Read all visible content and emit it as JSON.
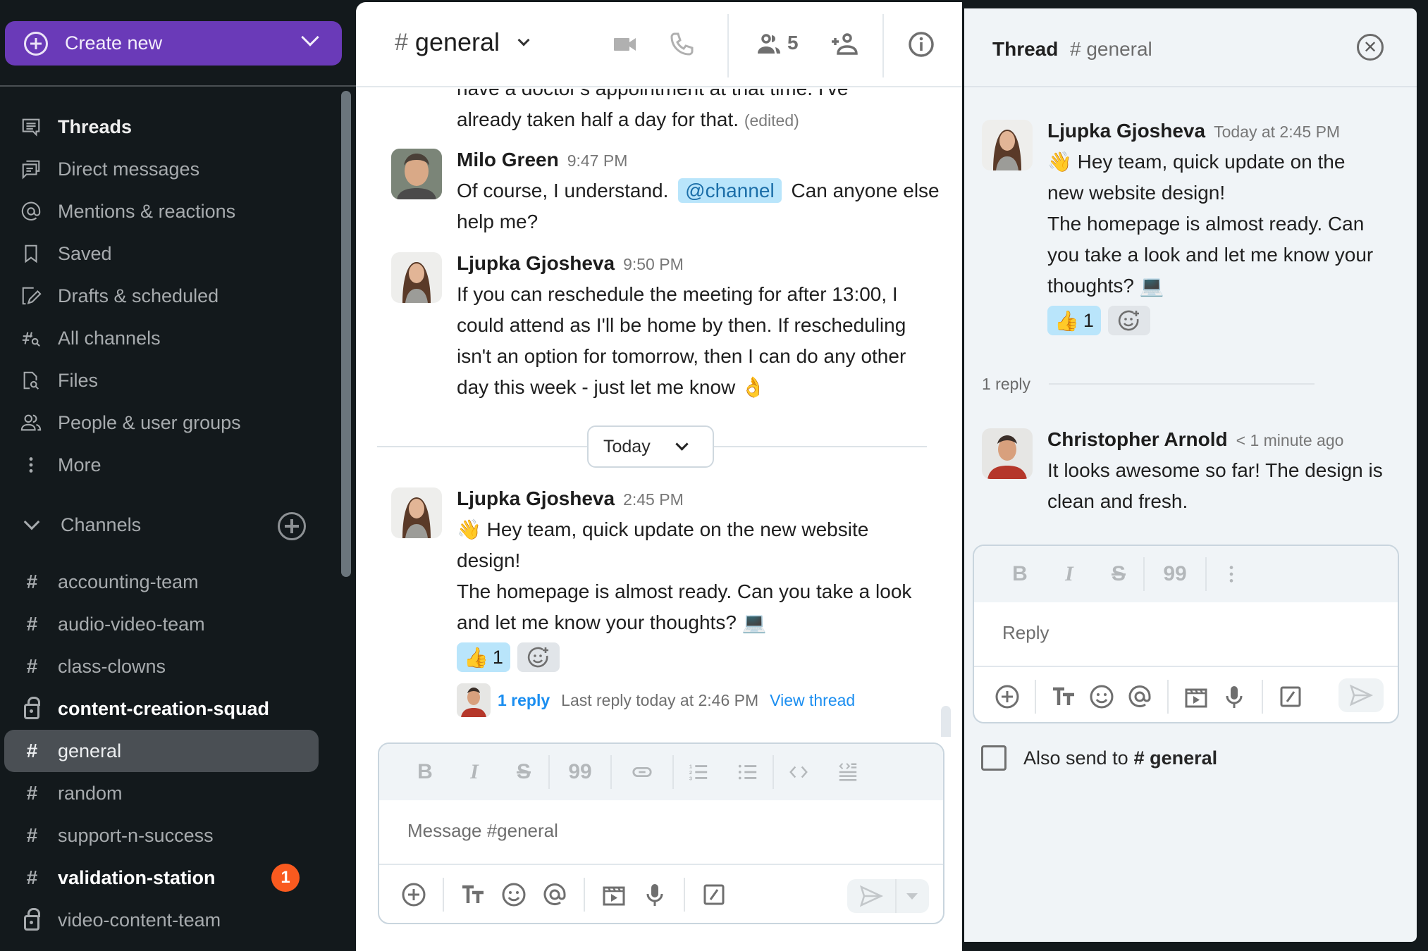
{
  "sidebar": {
    "create_button": {
      "label": "Create new",
      "color": "#6a3ab8"
    },
    "nav_items": [
      {
        "label": "Threads",
        "icon": "threads-icon",
        "bold": true
      },
      {
        "label": "Direct messages",
        "icon": "direct-messages-icon"
      },
      {
        "label": "Mentions & reactions",
        "icon": "at-sign-icon"
      },
      {
        "label": "Saved",
        "icon": "bookmark-icon"
      },
      {
        "label": "Drafts & scheduled",
        "icon": "drafts-icon"
      },
      {
        "label": "All channels",
        "icon": "channel-search-icon"
      },
      {
        "label": "Files",
        "icon": "file-search-icon"
      },
      {
        "label": "People & user groups",
        "icon": "people-icon"
      },
      {
        "label": "More",
        "icon": "more-vertical-icon"
      }
    ],
    "channels_header": "Channels",
    "channels": [
      {
        "name": "accounting-team",
        "type": "public"
      },
      {
        "name": "audio-video-team",
        "type": "public"
      },
      {
        "name": "class-clowns",
        "type": "public"
      },
      {
        "name": "content-creation-squad",
        "type": "private",
        "bold": true
      },
      {
        "name": "general",
        "type": "public",
        "active": true
      },
      {
        "name": "random",
        "type": "public"
      },
      {
        "name": "support-n-success",
        "type": "public"
      },
      {
        "name": "validation-station",
        "type": "public",
        "bold": true,
        "badge": "1"
      },
      {
        "name": "video-content-team",
        "type": "private"
      }
    ],
    "badge_color": "#f95a1f"
  },
  "main": {
    "header": {
      "hash": "#",
      "channel": "general",
      "member_count": "5"
    },
    "cutoff_text_top": "have a doctor's appointment at that time. I've",
    "cutoff_text": "already taken half a day for that.",
    "edited_label": "(edited)",
    "messages": [
      {
        "author": "Milo Green",
        "time": "9:47 PM",
        "text_before": "Of course, I understand.",
        "mention": "@channel",
        "text_after": "Can anyone else help me?"
      },
      {
        "author": "Ljupka Gjosheva",
        "time": "9:50 PM",
        "text": "If you can reschedule the meeting for after 13:00, I could attend as I'll be home by then. If rescheduling isn't an option for tomorrow, then I can do any other day this week - just let me know",
        "emoji": "👌"
      }
    ],
    "date_divider": "Today",
    "latest": {
      "author": "Ljupka Gjosheva",
      "time": "2:45 PM",
      "emoji_start": "👋",
      "line1": "Hey team, quick update on the new website design!",
      "line2": "The homepage is almost ready. Can you take a look and let me know your thoughts?",
      "emoji_end": "💻",
      "reaction_emoji": "👍",
      "reaction_count": "1",
      "reply_count": "1 reply",
      "last_reply": "Last reply today at 2:46 PM",
      "view_thread": "View thread"
    },
    "composer": {
      "placeholder": "Message #general"
    }
  },
  "thread": {
    "title": "Thread",
    "channel": "# general",
    "parent": {
      "author": "Ljupka Gjosheva",
      "time": "Today at 2:45 PM",
      "emoji_start": "👋",
      "line1": "Hey team, quick update on the new website design!",
      "line2": "The homepage is almost ready. Can you take a look and let me know your thoughts?",
      "emoji_end": "💻",
      "reaction_emoji": "👍",
      "reaction_count": "1"
    },
    "reply_count": "1 reply",
    "reply": {
      "author": "Christopher Arnold",
      "time": "< 1 minute ago",
      "text": "It looks awesome so far! The design is clean and fresh."
    },
    "composer": {
      "placeholder": "Reply"
    },
    "also_send_label": "Also send to",
    "also_send_channel": "# general",
    "also_send_checked": false
  },
  "colors": {
    "sidebar_bg": "#13191c",
    "mention_bg": "#b9e5fb",
    "link": "#1b8ef0",
    "thread_bg": "#f0f4f7"
  }
}
